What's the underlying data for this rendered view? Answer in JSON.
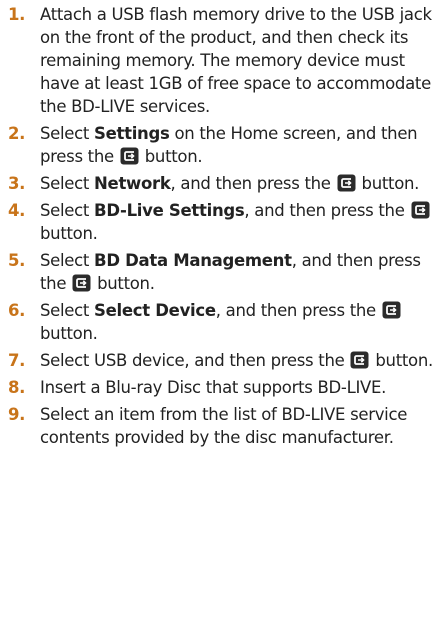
{
  "steps": [
    {
      "num": "1.",
      "text": "Attach a USB flash memory drive to the USB jack on the front of the product, and then check its remaining memory. The memory device must have at least 1GB of free space to accommodate the BD-LIVE services."
    },
    {
      "num": "2.",
      "pre": "Select ",
      "bold": "Settings",
      "mid": " on the Home screen, and then press the ",
      "post": " button."
    },
    {
      "num": "3.",
      "pre": "Select ",
      "bold": "Network",
      "mid": ", and then press the ",
      "post": " button."
    },
    {
      "num": "4.",
      "pre": "Select ",
      "bold": "BD-Live Settings",
      "mid": ", and then press the ",
      "post": " button."
    },
    {
      "num": "5.",
      "pre": "Select ",
      "bold": "BD Data Management",
      "mid": ", and then press the ",
      "post": " button."
    },
    {
      "num": "6.",
      "pre": "Select ",
      "bold": "Select Device",
      "mid": ", and then press the ",
      "post": " button."
    },
    {
      "num": "7.",
      "pre": "Select USB device, and then press the ",
      "post": " button."
    },
    {
      "num": "8.",
      "text": "Insert a Blu-ray Disc that supports BD-LIVE."
    },
    {
      "num": "9.",
      "text": "Select an item from the list of BD-LIVE service contents provided by the disc manufacturer."
    }
  ],
  "colors": {
    "number": "#c8741a",
    "text": "#222222",
    "icon": "#2b2b2b"
  },
  "icons": {
    "enter_button": "enter-button-icon"
  }
}
